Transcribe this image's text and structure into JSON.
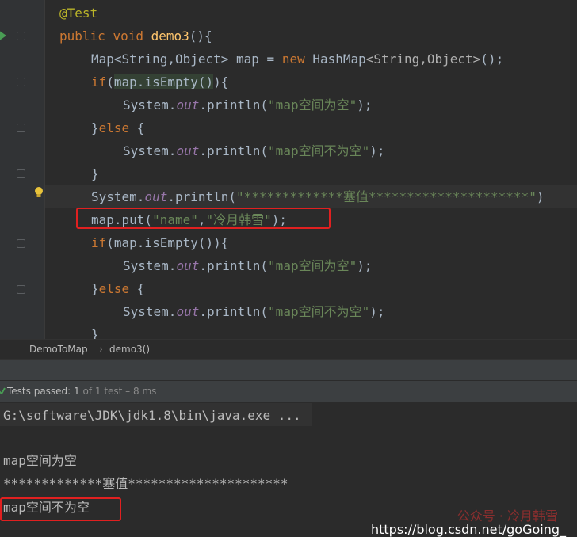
{
  "code": {
    "annotation": "@Test",
    "kw_public": "public",
    "kw_void": "void",
    "method_name": "demo3",
    "parens_open": "(){",
    "map_decl_type": "Map<String,Object>",
    "map_var": " map = ",
    "kw_new": "new",
    "hashmap": " HashMap",
    "generic": "<String,Object>",
    "stmt_end": "();",
    "kw_if": "if",
    "if_cond_open": "(",
    "if_cond_var": "map.isEmpty()",
    "if_cond_close": "){",
    "system": "System.",
    "out": "out",
    "println": ".println(",
    "str_empty": "\"map空间为空\"",
    "close_paren": ");",
    "else_open": "}",
    "kw_else": "else",
    "else_brace": " {",
    "str_not_empty": "\"map空间不为空\"",
    "close_brace": "}",
    "str_put": "\"*************塞值*********************\"",
    "trailing_paren": ")",
    "put_call": "map.put(",
    "put_key": "\"name\"",
    "put_comma": ",",
    "put_value": "\"冷月韩雪\"",
    "put_end": ");",
    "if2_cond": "(map.isEmpty()){"
  },
  "breadcrumb": {
    "class_name": "DemoToMap",
    "separator": "›",
    "method": "demo3()"
  },
  "test_status": {
    "passed_label": "Tests passed: ",
    "count": "1",
    "of_total": " of 1 test – 8 ms"
  },
  "console": {
    "command": "G:\\software\\JDK\\jdk1.8\\bin\\java.exe ...",
    "out_line1": "map空间为空",
    "out_line2": "*************塞值*********************",
    "out_line3": "map空间不为空"
  },
  "watermark": {
    "url": "https://blog.csdn.net/goGoing_",
    "overlay": "公众号 · 冷月韩雪"
  },
  "colors": {
    "keyword": "#cc7832",
    "string": "#6a8759",
    "annotation": "#bbb529",
    "method": "#ffc66d",
    "field": "#9876aa",
    "highlight_box": "#e02020"
  }
}
